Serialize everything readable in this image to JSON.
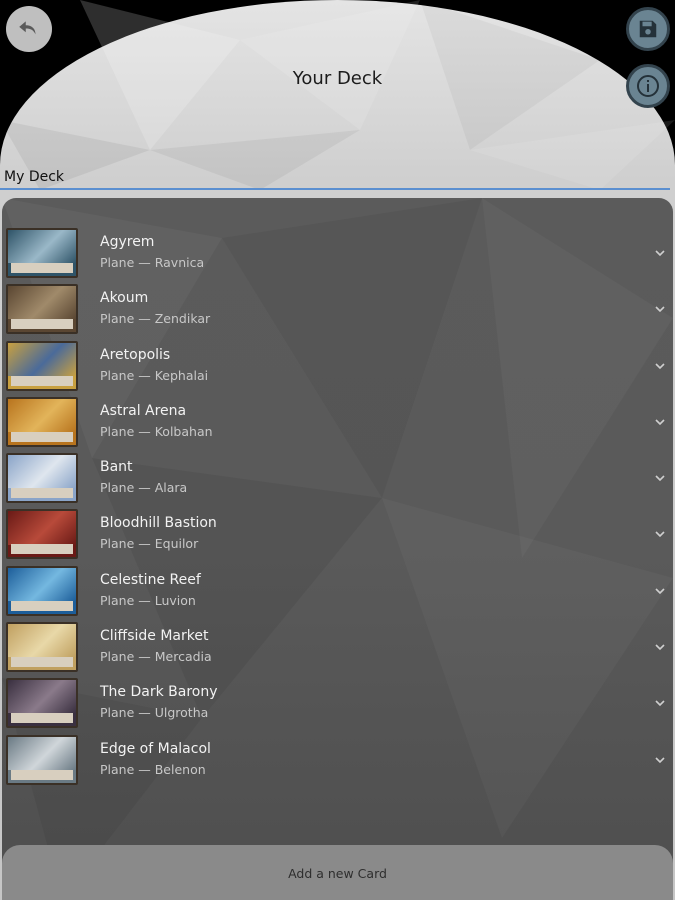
{
  "header": {
    "title": "Your Deck",
    "back_icon": "undo-arrow-icon",
    "save_icon": "floppy-disk-icon",
    "info_icon": "info-icon"
  },
  "deck": {
    "name": "My Deck"
  },
  "cards": [
    {
      "name": "Agyrem",
      "type": "Plane — Ravnica",
      "art_colors": [
        "#2f5468",
        "#9ab8c8"
      ]
    },
    {
      "name": "Akoum",
      "type": "Plane — Zendikar",
      "art_colors": [
        "#5a4632",
        "#a08a6a"
      ]
    },
    {
      "name": "Aretopolis",
      "type": "Plane — Kephalai",
      "art_colors": [
        "#c8a040",
        "#4a6a9a"
      ]
    },
    {
      "name": "Astral Arena",
      "type": "Plane — Kolbahan",
      "art_colors": [
        "#b8741e",
        "#e2b45a"
      ]
    },
    {
      "name": "Bant",
      "type": "Plane — Alara",
      "art_colors": [
        "#8aa4c8",
        "#dfe6ee"
      ]
    },
    {
      "name": "Bloodhill Bastion",
      "type": "Plane — Equilor",
      "art_colors": [
        "#6a1a16",
        "#b84a3a"
      ]
    },
    {
      "name": "Celestine Reef",
      "type": "Plane — Luvion",
      "art_colors": [
        "#1d5e9a",
        "#74b8e0"
      ]
    },
    {
      "name": "Cliffside Market",
      "type": "Plane — Mercadia",
      "art_colors": [
        "#c0a060",
        "#e8d8a8"
      ]
    },
    {
      "name": "The Dark Barony",
      "type": "Plane — Ulgrotha",
      "art_colors": [
        "#3a3040",
        "#8a7a8a"
      ]
    },
    {
      "name": "Edge of Malacol",
      "type": "Plane — Belenon",
      "art_colors": [
        "#6a7a84",
        "#d0d6da"
      ]
    }
  ],
  "footer": {
    "add_label": "Add a new Card"
  },
  "colors": {
    "accent_underline": "#5b8fd0",
    "panel": "#5a5a5a",
    "icon_button": "#6a8492"
  }
}
